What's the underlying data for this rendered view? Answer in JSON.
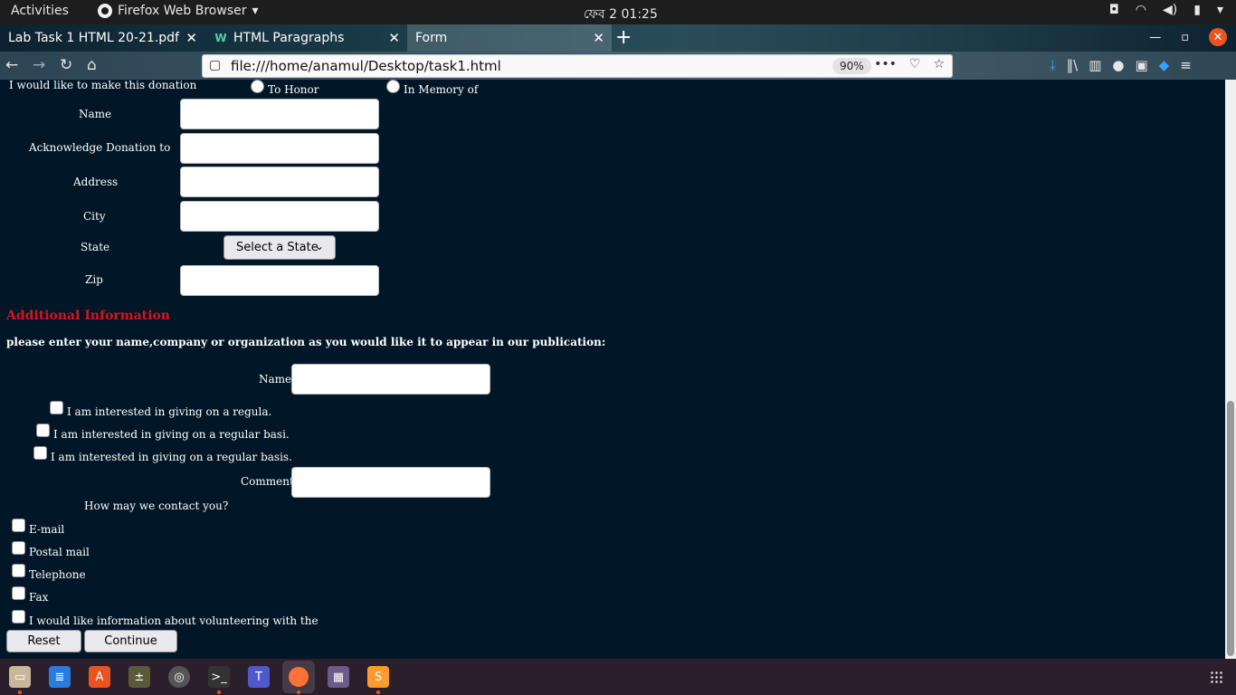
{
  "topbar": {
    "activities": "Activities",
    "app": "Firefox Web Browser",
    "clock": "ফেব 2  01:25"
  },
  "tabs": [
    {
      "label": "Lab Task 1 HTML 20-21.pdf"
    },
    {
      "label": "HTML Paragraphs"
    },
    {
      "label": "Form"
    }
  ],
  "nav": {
    "url": "file:///home/anamul/Desktop/task1.html",
    "zoom": "90%"
  },
  "form": {
    "donation_label": "I would like to make this donation",
    "radio_honor": "To Honor",
    "radio_memory": "In Memory of",
    "name_label": "Name",
    "ack_label": "Acknowledge Donation to",
    "address_label": "Address",
    "city_label": "City",
    "state_label": "State",
    "state_select": "Select a State",
    "zip_label": "Zip",
    "additional_heading": "Additional Information",
    "publication_text": "please enter your name,company or organization as you would like it to appear in our publication:",
    "name2_label": "Name",
    "interest1": "I am interested in giving on a regula.",
    "interest2": "I am interested in giving on a regular basi.",
    "interest3": "I am interested in giving on a regular basis.",
    "comment_label": "Comment",
    "contact_question": "How may we contact you?",
    "contact_options": [
      "E-mail",
      "Postal mail",
      "Telephone",
      "Fax"
    ],
    "volunteer": "I would like information about volunteering with the",
    "reset_button": "Reset",
    "continue_button": "Continue"
  },
  "scroll": {
    "position_fraction": 0.55
  }
}
